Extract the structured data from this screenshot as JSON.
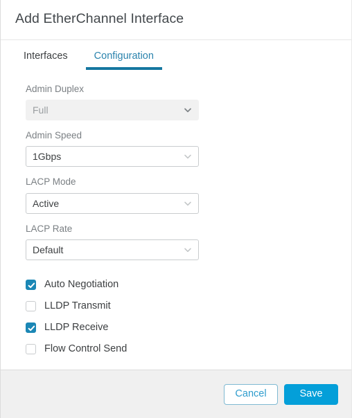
{
  "dialog": {
    "title": "Add EtherChannel Interface"
  },
  "tabs": [
    {
      "label": "Interfaces",
      "active": false
    },
    {
      "label": "Configuration",
      "active": true
    }
  ],
  "fields": [
    {
      "label": "Admin Duplex",
      "value": "Full",
      "disabled": true
    },
    {
      "label": "Admin Speed",
      "value": "1Gbps",
      "disabled": false
    },
    {
      "label": "LACP Mode",
      "value": "Active",
      "disabled": false
    },
    {
      "label": "LACP Rate",
      "value": "Default",
      "disabled": false
    }
  ],
  "checkboxes": [
    {
      "label": "Auto Negotiation",
      "checked": true
    },
    {
      "label": "LLDP Transmit",
      "checked": false
    },
    {
      "label": "LLDP Receive",
      "checked": true
    },
    {
      "label": "Flow Control Send",
      "checked": false
    }
  ],
  "footer": {
    "cancel_label": "Cancel",
    "save_label": "Save"
  },
  "colors": {
    "accent_blue": "#049fd9",
    "tab_active": "#2a83ad",
    "tab_underline": "#1577a0",
    "checkbox_checked": "#1b87b5",
    "footer_bg": "#f0f0f0",
    "disabled_bg": "#f1f1f1"
  },
  "icons": {
    "chevron_down": "chevron-down-icon",
    "checkmark": "checkmark-icon"
  }
}
